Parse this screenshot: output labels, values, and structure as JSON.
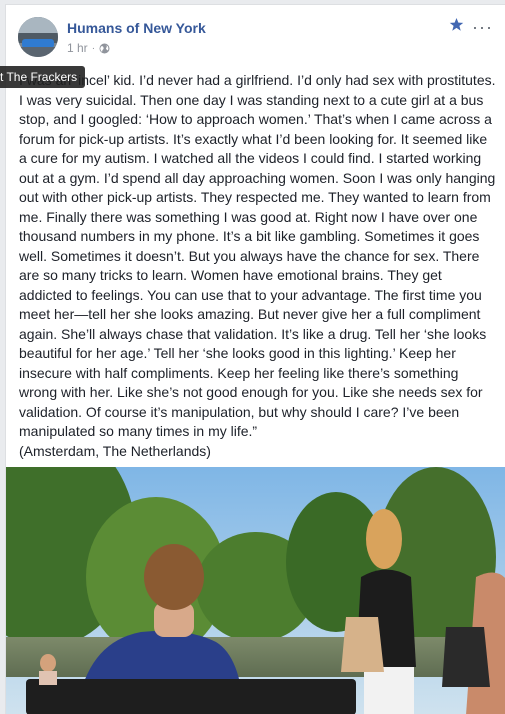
{
  "post": {
    "page_name": "Humans of New York",
    "time": "1 hr",
    "privacy_icon": "globe-icon",
    "body": "I was an ‘incel’ kid. I’d never had a girlfriend. I’d only had sex with prostitutes. I was very suicidal. Then one day I was standing next to a cute girl at a bus stop, and I googled: ‘How to approach women.’ That’s when I came across a forum for pick-up artists. It’s exactly what I’d been looking for. It seemed like a cure for my autism. I watched all the videos I could find. I started working out at a gym. I’d spend all day approaching women. Soon I was only hanging out with other pick-up artists. They respected me. They wanted to learn from me. Finally there was something I was good at. Right now I have over one thousand numbers in my phone. It’s a bit like gambling. Sometimes it goes well. Sometimes it doesn’t. But you always have the chance for sex. There are so many tricks to learn. Women have emotional brains. They get addicted to feelings. You can use that to your advantage. The first time you meet her—tell her she looks amazing. But never give her a full compliment again. She’ll always chase that validation. It’s like a drug. Tell her ‘she looks beautiful for her age.’ Tell her ‘she looks good in this lighting.’ Keep her insecure with half compliments. Keep her feeling like there’s something wrong with her. Like she’s not good enough for you. Like she needs sex for validation. Of course it’s manipulation, but why should I care? I’ve been manipulated so many times in my life.”",
    "location": "(Amsterdam, The Netherlands)"
  },
  "tooltip": {
    "text": "t The Frackers"
  },
  "icons": {
    "favorite": "star-icon",
    "more": "more-options-icon"
  },
  "colors": {
    "link": "#365899",
    "text": "#1d2129",
    "meta": "#90949c",
    "star": "#4267b2"
  }
}
